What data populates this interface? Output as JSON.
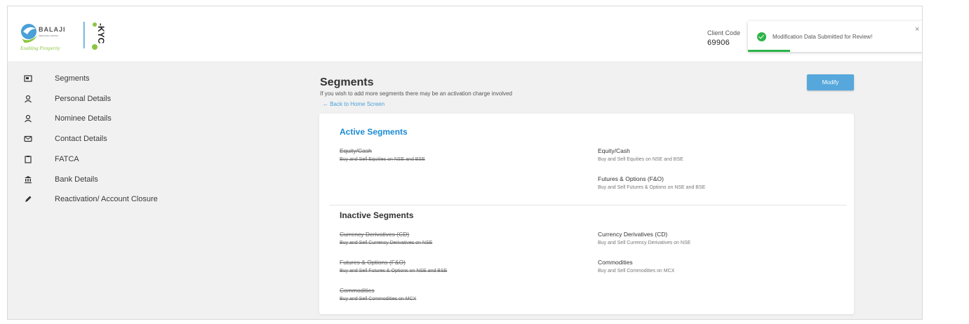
{
  "brand": {
    "name": "BALAJI",
    "subtitle": "SERVICES LIMITED",
    "tagline": "Enabling Prosperity",
    "product": "e-KYC"
  },
  "header": {
    "client_code_label": "Client Code",
    "client_code_value": "69906"
  },
  "toast": {
    "message": "Modification Data Submitted for Review!",
    "close_label": "×",
    "icon": "check-circle-icon",
    "color": "#2eb44a"
  },
  "sidebar": {
    "items": [
      {
        "label": "Segments",
        "icon": "segments-icon"
      },
      {
        "label": "Personal Details",
        "icon": "user-icon"
      },
      {
        "label": "Nominee Details",
        "icon": "user-icon"
      },
      {
        "label": "Contact Details",
        "icon": "mail-icon"
      },
      {
        "label": "FATCA",
        "icon": "clipboard-icon"
      },
      {
        "label": "Bank Details",
        "icon": "bank-icon"
      },
      {
        "label": "Reactivation/ Account Closure",
        "icon": "pencil-icon"
      }
    ]
  },
  "main": {
    "title": "Segments",
    "subtitle": "If you wish to add more segments there may be an activation charge involved",
    "back_link": "← Back to Home Screen",
    "modify_label": "Modify",
    "accent_color": "#56a8dc"
  },
  "active_segments": {
    "title": "Active Segments",
    "left": [
      {
        "name": "Equity/Cash",
        "desc": "Buy and Sell Equities on NSE and BSE"
      }
    ],
    "right": [
      {
        "name": "Equity/Cash",
        "desc": "Buy and Sell Equities on NSE and BSE"
      },
      {
        "name": "Futures & Options (F&O)",
        "desc": "Buy and Sell Futures & Options on NSE and BSE"
      }
    ]
  },
  "inactive_segments": {
    "title": "Inactive Segments",
    "left": [
      {
        "name": "Currency Derivatives (CD)",
        "desc": "Buy and Sell Currency Derivatives on NSE"
      },
      {
        "name": "Futures & Options (F&O)",
        "desc": "Buy and Sell Futures & Options on NSE and BSE"
      },
      {
        "name": "Commodities",
        "desc": "Buy and Sell Commodities on MCX"
      }
    ],
    "right": [
      {
        "name": "Currency Derivatives (CD)",
        "desc": "Buy and Sell Currency Derivatives on NSE"
      },
      {
        "name": "Commodities",
        "desc": "Buy and Sell Commodities on MCX"
      }
    ]
  }
}
